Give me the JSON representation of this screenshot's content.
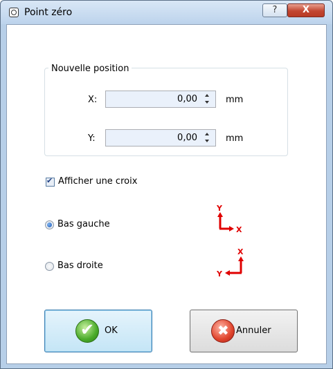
{
  "window": {
    "title": "Point zéro",
    "help_label": "?",
    "close_label": "X"
  },
  "position": {
    "group_title": "Nouvelle position",
    "x": {
      "label": "X:",
      "value": "0,00",
      "unit": "mm"
    },
    "y": {
      "label": "Y:",
      "value": "0,00",
      "unit": "mm"
    }
  },
  "show_cross": {
    "label": "Afficher une croix",
    "checked": true
  },
  "origin": {
    "options": [
      {
        "label": "Bas gauche",
        "selected": true,
        "axis_y": "Y",
        "axis_x": "X"
      },
      {
        "label": "Bas droite",
        "selected": false,
        "axis_y": "X",
        "axis_x": "Y"
      }
    ]
  },
  "buttons": {
    "ok": "OK",
    "cancel": "Annuler"
  },
  "colors": {
    "axis": "#e00000",
    "accent": "#3c7fb1"
  }
}
